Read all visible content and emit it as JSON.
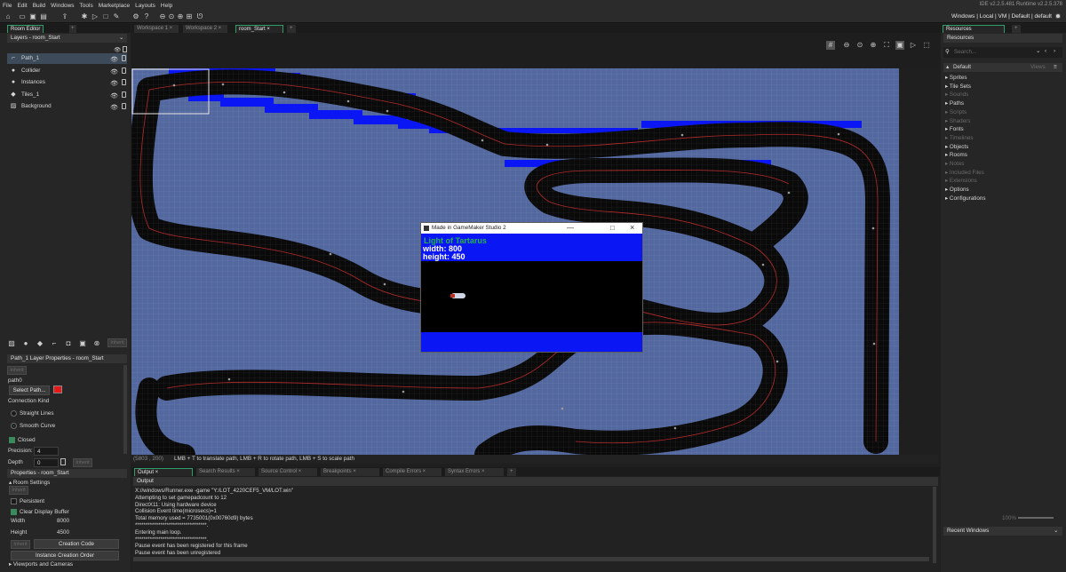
{
  "menu": [
    "File",
    "Edit",
    "Build",
    "Windows",
    "Tools",
    "Marketplace",
    "Layouts",
    "Help"
  ],
  "ide_version": "IDE v2.2.5.481 Runtime v2.2.5.378",
  "target": "Windows | Local | VM | Default | default",
  "workspace_tabs": [
    "Workspace 1",
    "Workspace 2",
    "room_Start"
  ],
  "room_editor": {
    "tab": "Room Editor",
    "layers_title": "Layers - room_Start",
    "layers": [
      {
        "name": "Path_1",
        "icon": "path-layer-icon",
        "selected": true
      },
      {
        "name": "Collider",
        "icon": "instance-layer-icon",
        "selected": false
      },
      {
        "name": "Instances",
        "icon": "instance-layer-icon",
        "selected": false
      },
      {
        "name": "Tiles_1",
        "icon": "tile-layer-icon",
        "selected": false
      },
      {
        "name": "Background",
        "icon": "background-layer-icon",
        "selected": false
      }
    ],
    "inherit": "Inherit"
  },
  "path_props": {
    "title": "Path_1 Layer Properties - room_Start",
    "inherit": "Inherit",
    "path_name": "path0",
    "select_path": "Select Path...",
    "path_color": "#e81818",
    "connection_kind": "Connection Kind",
    "straight": "Straight Lines",
    "smooth": "Smooth Curve",
    "smooth_selected": true,
    "closed": "Closed",
    "closed_checked": true,
    "precision_label": "Precision:",
    "precision": "4",
    "depth_label": "Depth",
    "depth": "0",
    "depth_inherit": "Inherit"
  },
  "room_props": {
    "title": "Properties - room_Start",
    "inherit": "Inherit",
    "settings": "Room Settings",
    "persistent": "Persistent",
    "persistent_checked": false,
    "clear_display": "Clear Display Buffer",
    "clear_display_checked": true,
    "width_label": "Width",
    "width": "8000",
    "height_label": "Height",
    "height": "4500",
    "inherit2": "Inherit",
    "creation_code": "Creation Code",
    "instance_order": "Instance Creation Order",
    "viewports": "Viewports and Cameras"
  },
  "status": {
    "coords": "(5803 , 200)",
    "hint": "LMB + T to translate path, LMB + R to rotate path, LMB + S to scale path"
  },
  "game_window": {
    "title": "Made in GameMaker Studio 2",
    "game_title": "Light of Tartarus",
    "width_text": "width: 800",
    "height_text": "height: 450"
  },
  "output": {
    "tabs": [
      "Output",
      "Search Results",
      "Source Control",
      "Breakpoints",
      "Compile Errors",
      "Syntax Errors"
    ],
    "header": "Output",
    "lines": [
      "X://windows/Runner.exe  -game \"Y:/LOT_4220CEF5_VM/LOT.win\"",
      "Attempting to set gamepadcount to 12",
      "DirectX11: Using hardware device",
      "Collision Event time(microsecs)=1",
      "Total memory used = 7735001(0x00760d9) bytes",
      "**********************************.",
      "Entering main loop.",
      "**********************************.",
      "Pause event has been registered for this frame",
      "Pause event has been unregistered"
    ]
  },
  "resources": {
    "tab": "Resources",
    "header": "Resources",
    "search_placeholder": "Search...",
    "group": "Default",
    "views": "Views",
    "items": [
      {
        "name": "Sprites",
        "active": true
      },
      {
        "name": "Tile Sets",
        "active": true
      },
      {
        "name": "Sounds",
        "active": false
      },
      {
        "name": "Paths",
        "active": true
      },
      {
        "name": "Scripts",
        "active": false
      },
      {
        "name": "Shaders",
        "active": false
      },
      {
        "name": "Fonts",
        "active": true
      },
      {
        "name": "Timelines",
        "active": false
      },
      {
        "name": "Objects",
        "active": true
      },
      {
        "name": "Rooms",
        "active": true
      },
      {
        "name": "Notes",
        "active": false
      },
      {
        "name": "Included Files",
        "active": false
      },
      {
        "name": "Extensions",
        "active": false
      },
      {
        "name": "Options",
        "active": true
      },
      {
        "name": "Configurations",
        "active": true
      }
    ],
    "zoom": "100%",
    "recent": "Recent Windows"
  }
}
